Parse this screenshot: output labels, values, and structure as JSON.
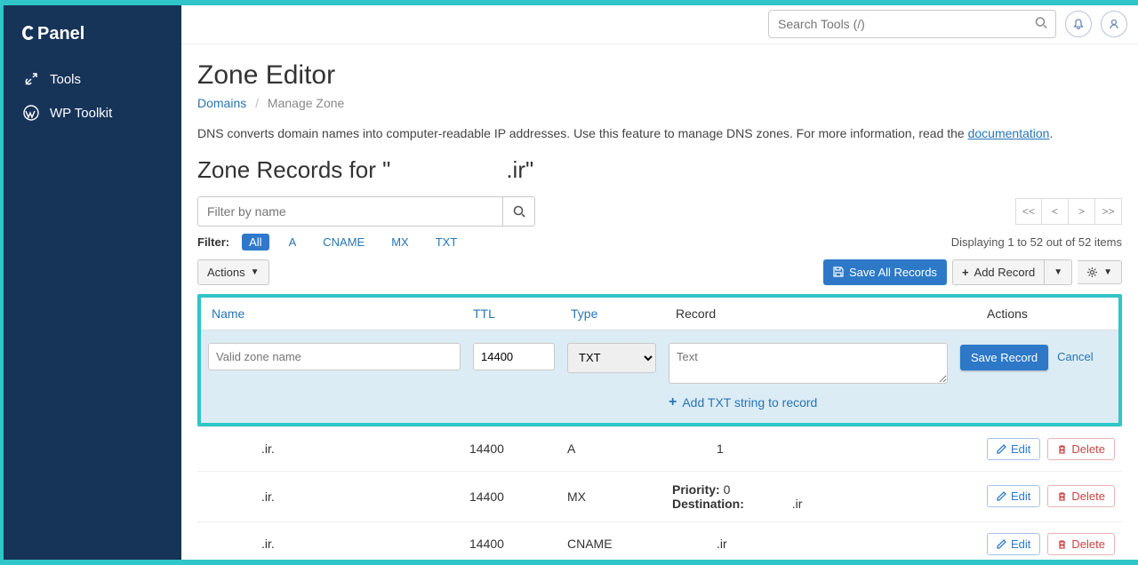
{
  "brand": "cPanel",
  "sidebar": {
    "items": [
      {
        "label": "Tools",
        "icon": "tools"
      },
      {
        "label": "WP Toolkit",
        "icon": "wp"
      }
    ]
  },
  "topbar": {
    "search_placeholder": "Search Tools (/)"
  },
  "page": {
    "title": "Zone Editor",
    "breadcrumb": {
      "root": "Domains",
      "current": "Manage Zone"
    },
    "description_pre": "DNS converts domain names into computer-readable IP addresses. Use this feature to manage DNS zones. For more information, read the ",
    "description_link": "documentation",
    "description_post": ".",
    "subtitle_pre": "Zone Records for \"",
    "subtitle_domain": "",
    "subtitle_post": ".ir\""
  },
  "filter": {
    "placeholder": "Filter by name",
    "label": "Filter:",
    "tags": [
      "All",
      "A",
      "CNAME",
      "MX",
      "TXT"
    ],
    "displaying": "Displaying 1 to 52 out of 52 items"
  },
  "toolbar": {
    "actions": "Actions",
    "save_all": "Save All Records",
    "add_record": "Add Record"
  },
  "pager": [
    "<<",
    "<",
    ">",
    ">>"
  ],
  "columns": {
    "name": "Name",
    "ttl": "TTL",
    "type": "Type",
    "record": "Record",
    "actions": "Actions"
  },
  "newrec": {
    "name_ph": "Valid zone name",
    "ttl_val": "14400",
    "type_val": "TXT",
    "text_ph": "Text",
    "add_string": "Add TXT string to record",
    "save": "Save Record",
    "cancel": "Cancel"
  },
  "rows": [
    {
      "name": ".ir.",
      "ttl": "14400",
      "type": "A",
      "record": "1",
      "mx": false
    },
    {
      "name": ".ir.",
      "ttl": "14400",
      "type": "MX",
      "priority": "0",
      "dest": ".ir",
      "mx": true
    },
    {
      "name": ".ir.",
      "ttl": "14400",
      "type": "CNAME",
      "record": ".ir",
      "mx": false
    }
  ],
  "row_buttons": {
    "edit": "Edit",
    "del": "Delete"
  },
  "mx_labels": {
    "priority": "Priority:",
    "dest": "Destination:"
  }
}
